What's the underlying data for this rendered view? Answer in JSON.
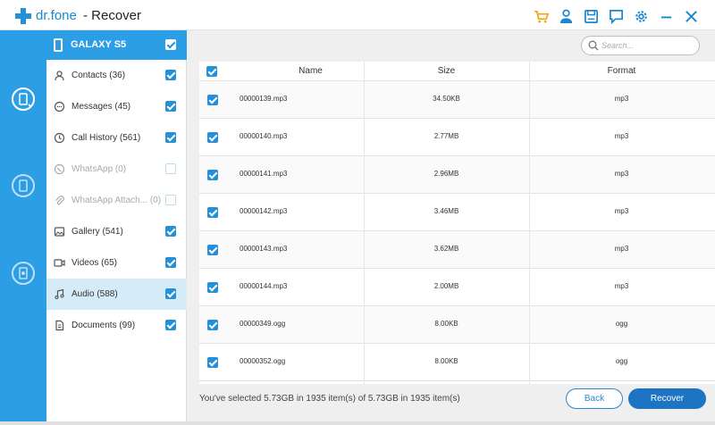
{
  "app": {
    "brand": "dr.fone",
    "title": "- Recover"
  },
  "toolbar_icons": [
    "cart-icon",
    "user-icon",
    "save-icon",
    "feedback-icon",
    "settings-icon",
    "minimize-icon",
    "close-icon"
  ],
  "device": {
    "name": "GALAXY S5",
    "checked": true
  },
  "categories": [
    {
      "label": "Contacts (36)",
      "icon": "contacts-icon",
      "checked": true,
      "disabled": false
    },
    {
      "label": "Messages (45)",
      "icon": "messages-icon",
      "checked": true,
      "disabled": false
    },
    {
      "label": "Call History (561)",
      "icon": "call-history-icon",
      "checked": true,
      "disabled": false
    },
    {
      "label": "WhatsApp (0)",
      "icon": "whatsapp-icon",
      "checked": false,
      "disabled": true
    },
    {
      "label": "WhatsApp Attach...  (0)",
      "icon": "attachment-icon",
      "checked": false,
      "disabled": true
    },
    {
      "label": "Gallery (541)",
      "icon": "gallery-icon",
      "checked": true,
      "disabled": false
    },
    {
      "label": "Videos (65)",
      "icon": "video-icon",
      "checked": true,
      "disabled": false
    },
    {
      "label": "Audio (588)",
      "icon": "audio-icon",
      "checked": true,
      "disabled": false,
      "selected": true
    },
    {
      "label": "Documents (99)",
      "icon": "documents-icon",
      "checked": true,
      "disabled": false
    }
  ],
  "search": {
    "placeholder": "Search..."
  },
  "table": {
    "headers": {
      "name": "Name",
      "size": "Size",
      "format": "Format"
    },
    "rows": [
      {
        "name": "00000139.mp3",
        "size": "34.50KB",
        "format": "mp3"
      },
      {
        "name": "00000140.mp3",
        "size": "2.77MB",
        "format": "mp3"
      },
      {
        "name": "00000141.mp3",
        "size": "2.96MB",
        "format": "mp3"
      },
      {
        "name": "00000142.mp3",
        "size": "3.46MB",
        "format": "mp3"
      },
      {
        "name": "00000143.mp3",
        "size": "3.62MB",
        "format": "mp3"
      },
      {
        "name": "00000144.mp3",
        "size": "2.00MB",
        "format": "mp3"
      },
      {
        "name": "00000349.ogg",
        "size": "8.00KB",
        "format": "ogg"
      },
      {
        "name": "00000352.ogg",
        "size": "8.00KB",
        "format": "ogg"
      }
    ]
  },
  "footer": {
    "status": "You've selected 5.73GB in 1935 item(s) of 5.73GB in 1935 item(s)",
    "back_label": "Back",
    "recover_label": "Recover"
  },
  "colors": {
    "accent": "#2c9ee5",
    "primary_button": "#1c74c2",
    "toolbar_cart": "#f0a30a"
  }
}
